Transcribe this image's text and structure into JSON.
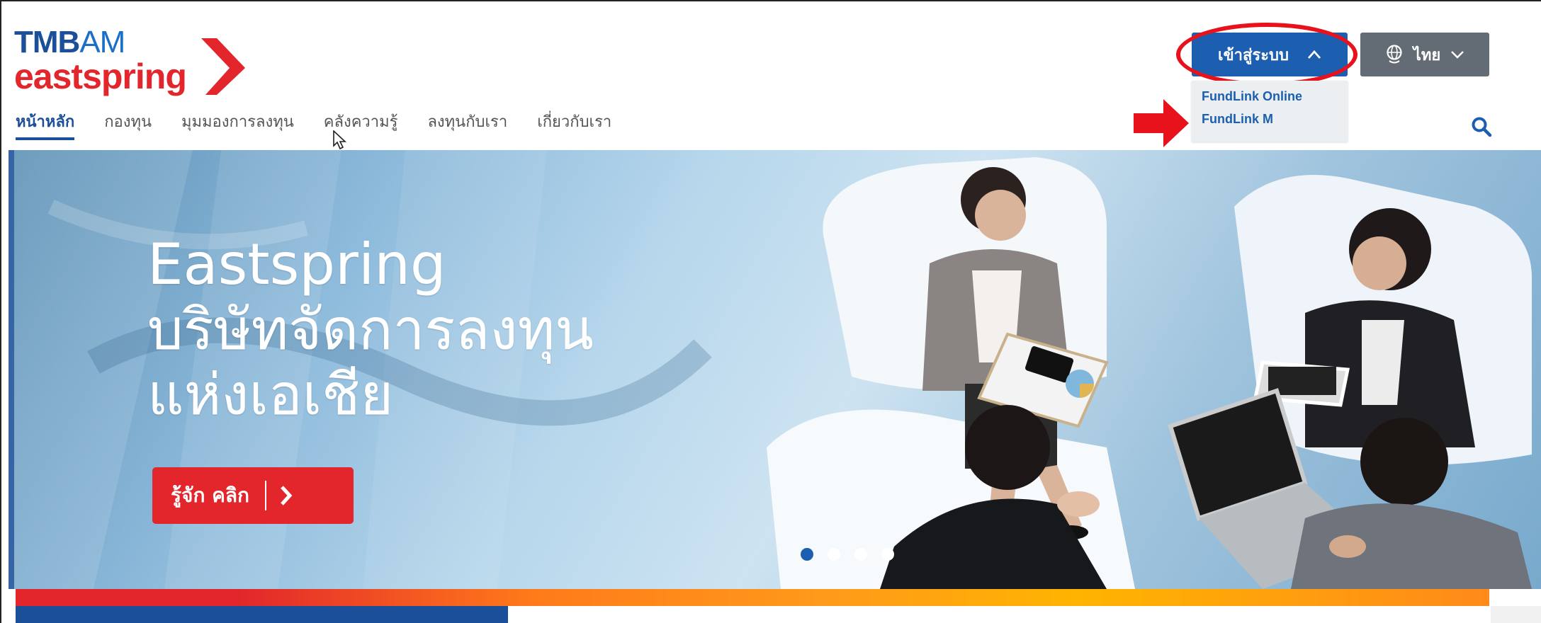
{
  "logo": {
    "tmb": "TMB",
    "am": "AM",
    "eastspring": "eastspring"
  },
  "nav": {
    "items": [
      {
        "label": "หน้าหลัก"
      },
      {
        "label": "กองทุน"
      },
      {
        "label": "มุมมองการลงทุน"
      },
      {
        "label": "คลังความรู้"
      },
      {
        "label": "ลงทุนกับเรา"
      },
      {
        "label": "เกี่ยวกับเรา"
      }
    ]
  },
  "header": {
    "login_label": "เข้าสู่ระบบ",
    "language_label": "ไทย"
  },
  "login_menu": {
    "items": [
      {
        "label": "FundLink Online"
      },
      {
        "label": "FundLink M"
      }
    ]
  },
  "hero": {
    "title_line1": "Eastspring",
    "title_line2": "บริษัทจัดการลงทุน",
    "title_line3": "แห่งเอเชีย",
    "cta_label": "รู้จัก คลิก",
    "slide_count": 4,
    "active_slide": 1
  },
  "colors": {
    "brand_blue": "#1c5fb0",
    "brand_red": "#e2262b",
    "annotation_red": "#e8121c",
    "language_button_gray": "#636c75"
  },
  "icons": {
    "search": "search-icon",
    "chevron_up": "chevron-up-icon",
    "chevron_down": "chevron-down-icon",
    "globe": "globe-icon",
    "arrow_right": "arrow-right-icon"
  }
}
